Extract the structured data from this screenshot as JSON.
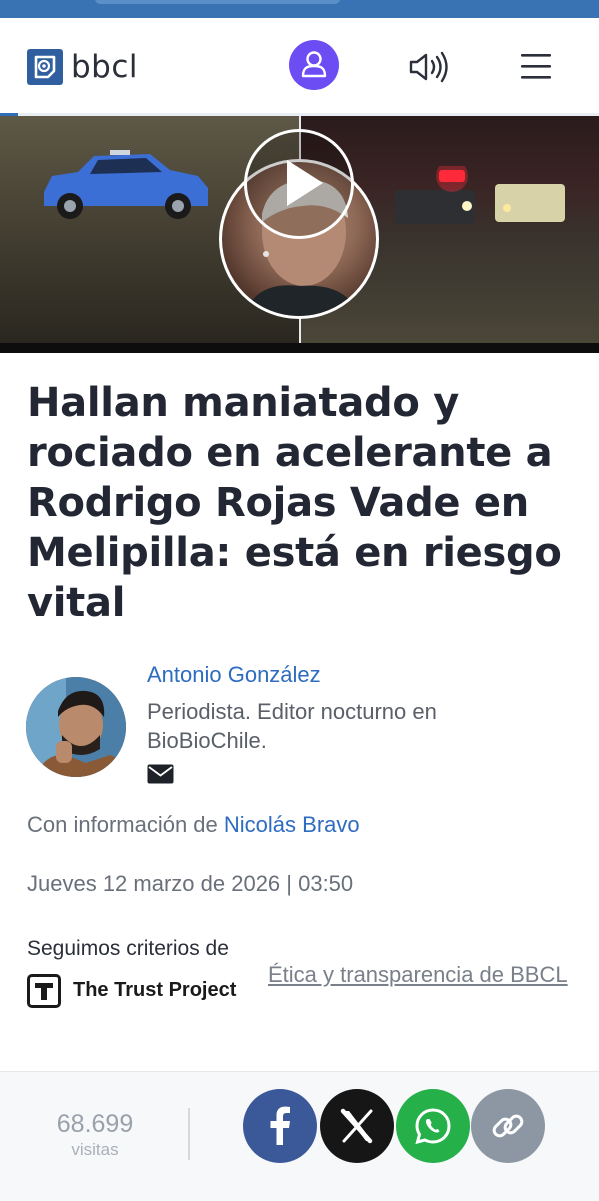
{
  "site": {
    "brand": "bbcl",
    "accent_color": "#2f5f9e",
    "user_button_color": "#6c4df4",
    "icons": {
      "logo": "bbcl-logo-icon",
      "user": "user-icon",
      "speaker": "speaker-icon",
      "menu": "hamburger-menu-icon"
    }
  },
  "hero": {
    "play_icon": "play-icon"
  },
  "article": {
    "title": "Hallan maniatado y rociado en acelerante a Rodrigo Rojas Vade en Melipilla: está en riesgo vital",
    "author": {
      "name": "Antonio González",
      "bio": "Periodista. Editor nocturno en BioBioChile.",
      "contact_icon": "mail-icon"
    },
    "with_info_prefix": "Con información de",
    "with_info_name": "Nicolás Bravo",
    "date": "Jueves 12 marzo de 2026 | 03:50",
    "criteria_label": "Seguimos criterios de",
    "trust_project": "The Trust Project",
    "ethics_link": "Ética y transparencia de BBCL"
  },
  "bottom_bar": {
    "visits_count": "68.699",
    "visits_label": "visitas",
    "share_buttons": [
      {
        "name": "facebook",
        "icon": "facebook-icon",
        "color": "#3b5998"
      },
      {
        "name": "x",
        "icon": "x-icon",
        "color": "#161616"
      },
      {
        "name": "whatsapp",
        "icon": "whatsapp-icon",
        "color": "#25b04a"
      },
      {
        "name": "copy-link",
        "icon": "link-icon",
        "color": "#8d97a3"
      }
    ]
  },
  "reading_progress": 0.03
}
